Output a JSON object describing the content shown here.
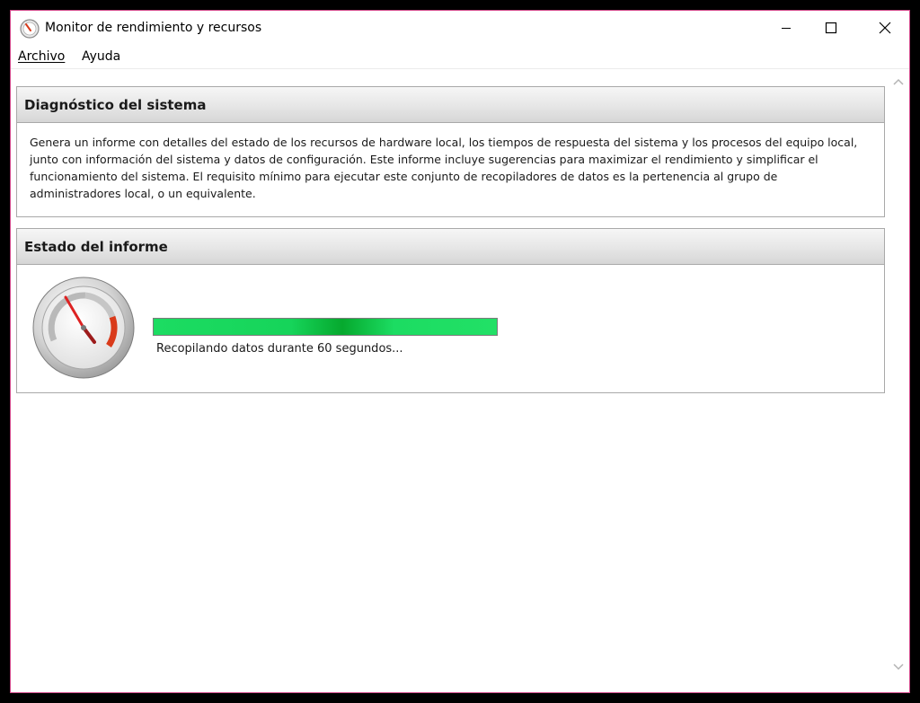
{
  "window": {
    "title": "Monitor de rendimiento y recursos",
    "icon": "performance-gauge-icon"
  },
  "menu": {
    "archivo": "Archivo",
    "ayuda": "Ayuda"
  },
  "diagnostico": {
    "header": "Diagnóstico del sistema",
    "description": "Genera un informe con detalles del estado de los recursos de hardware local, los tiempos de respuesta del sistema y los procesos del equipo local, junto con información del sistema y datos de configuración. Este informe incluye sugerencias para maximizar el rendimiento y simplificar el funcionamiento del sistema. El requisito mínimo para ejecutar este conjunto de recopiladores de datos es la pertenencia al grupo de administradores local, o un equivalente."
  },
  "estado": {
    "header": "Estado del informe",
    "progress_fraction": 1.0,
    "progress_text": "Recopilando datos durante 60 segundos...",
    "gauge_icon": "performance-gauge-icon"
  },
  "colors": {
    "progress_green": "#1cdc62",
    "progress_dark_green": "#06a92e",
    "gauge_red": "#d93a1a"
  }
}
